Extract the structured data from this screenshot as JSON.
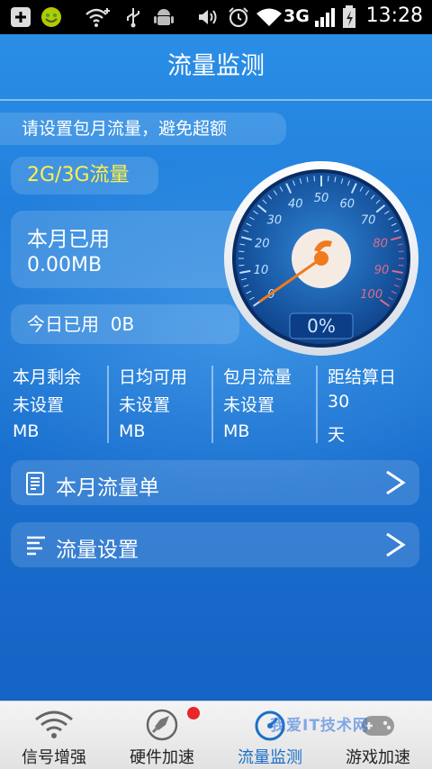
{
  "status_bar": {
    "time": "13:28",
    "network": "3G",
    "icons": [
      "add-icon",
      "smiley-icon",
      "wifi-add-icon",
      "usb-icon",
      "android-icon",
      "vibrate-icon",
      "alarm-icon",
      "wifi-icon",
      "signal-icon",
      "battery-charging-icon"
    ]
  },
  "app": {
    "title": "流量监测",
    "hint": "请设置包月流量，避免超额",
    "network_type": "2G/3G流量",
    "month_used_label": "本月已用",
    "month_used_value": "0.00MB",
    "today_used_label": "今日已用",
    "today_used_value": "0B",
    "gauge": {
      "percent_text": "0%",
      "percent_value": 0,
      "ticks": [
        "0",
        "10",
        "20",
        "30",
        "40",
        "50",
        "60",
        "70",
        "80",
        "90",
        "100"
      ]
    },
    "stats": [
      {
        "label": "本月剩余",
        "value": "未设置",
        "unit": "MB"
      },
      {
        "label": "日均可用",
        "value": "未设置",
        "unit": "MB"
      },
      {
        "label": "包月流量",
        "value": "未设置",
        "unit": "MB"
      },
      {
        "label": "距结算日",
        "value": "30",
        "unit": "天"
      }
    ],
    "rows": [
      {
        "label": "本月流量单",
        "arrow": ">"
      },
      {
        "label": "流量设置",
        "arrow": ">"
      }
    ]
  },
  "tabs": [
    {
      "label": "信号增强",
      "icon": "wifi-signal-icon"
    },
    {
      "label": "硬件加速",
      "icon": "rocket-icon"
    },
    {
      "label": "流量监测",
      "icon": "speedometer-icon"
    },
    {
      "label": "游戏加速",
      "icon": "gamepad-icon"
    }
  ],
  "watermark": "我爱IT技术网",
  "colors": {
    "accent": "#1d78d6",
    "highlight": "#fff14a",
    "needle": "#f07a1e",
    "badge": "#e8262c"
  }
}
